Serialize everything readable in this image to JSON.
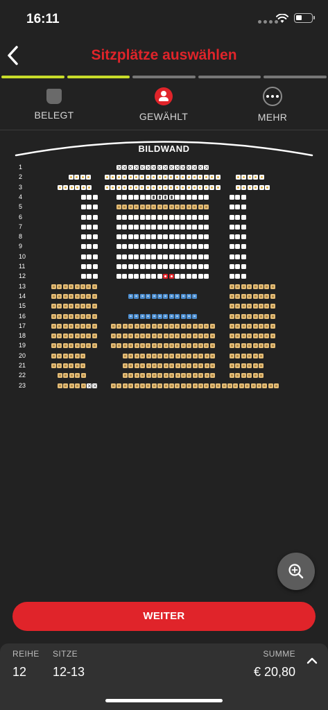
{
  "status_bar": {
    "time": "16:11"
  },
  "header": {
    "title": "Sitzplätze auswählen",
    "back_icon": "chevron-left-icon"
  },
  "progress": {
    "steps_total": 5,
    "steps_done": 2,
    "done_color": "#c8dc2a",
    "todo_color": "#777777"
  },
  "legend": {
    "items": [
      {
        "label": "BELEGT",
        "icon": "occupied-seat-icon"
      },
      {
        "label": "GEWÄHLT",
        "icon": "selected-person-icon"
      },
      {
        "label": "MEHR",
        "icon": "more-icon"
      }
    ]
  },
  "screen": {
    "label": "BILDWAND"
  },
  "seat_map": {
    "rows": [
      "1",
      "2",
      "3",
      "4",
      "5",
      "6",
      "7",
      "8",
      "9",
      "10",
      "11",
      "12",
      "13",
      "14",
      "15",
      "16",
      "17",
      "18",
      "19",
      "20",
      "21",
      "22",
      "23"
    ],
    "seat_types": [
      "free",
      "occupied",
      "gold",
      "loge",
      "blue",
      "wheel",
      "selected"
    ],
    "colors": {
      "selected": "#e0242a",
      "loge": "#e4bd78",
      "blue": "#4d8ed0",
      "free": "#ffffff"
    }
  },
  "zoom_button": {
    "icon": "zoom-in-icon"
  },
  "actions": {
    "continue_label": "WEITER"
  },
  "summary": {
    "row_header": "REIHE",
    "row_value": "12",
    "seats_header": "SITZE",
    "seats_value": "12-13",
    "total_header": "SUMME",
    "total_value": "€ 20,80",
    "expand_icon": "chevron-up-icon"
  },
  "accent_color": "#e0242a"
}
